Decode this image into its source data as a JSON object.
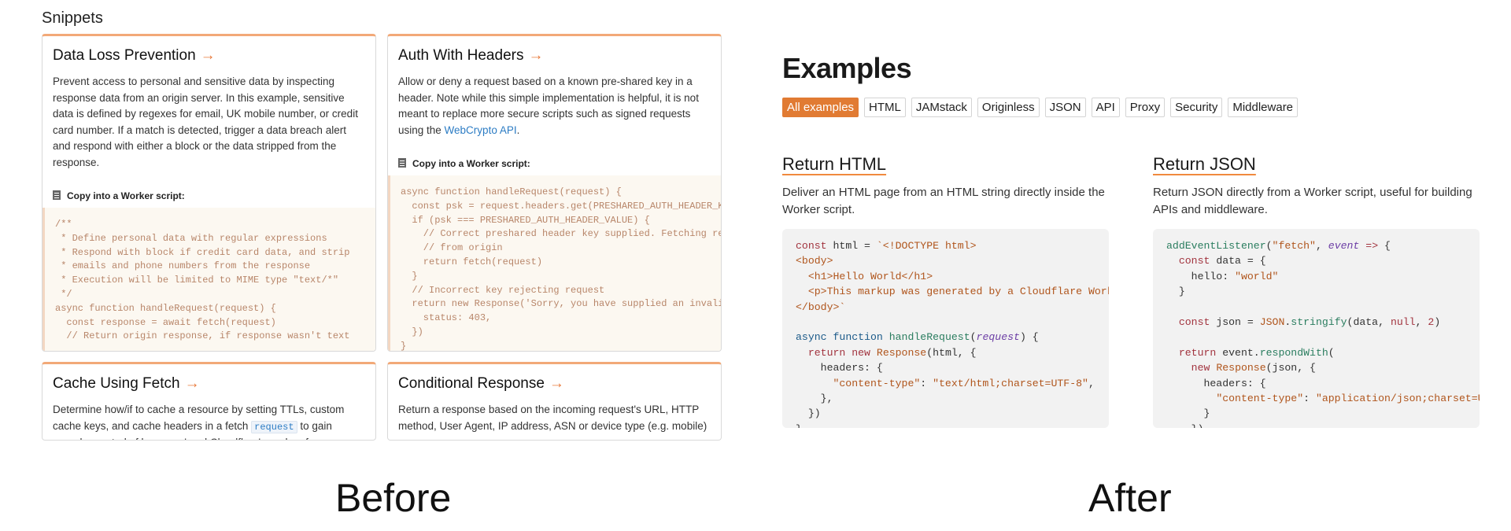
{
  "before": {
    "heading": "Snippets",
    "cards": [
      {
        "title": "Data Loss Prevention",
        "arrow": "→",
        "description": "Prevent access to personal and sensitive data by inspecting response data from an origin server. In this example, sensitive data is defined by regexes for email, UK mobile number, or credit card number. If a match is detected, trigger a data breach alert and respond with either a block or the data stripped from the response.",
        "copy_label": "Copy into a Worker script:",
        "code": "/**\n * Define personal data with regular expressions\n * Respond with block if credit card data, and strip\n * emails and phone numbers from the response\n * Execution will be limited to MIME type \"text/*\"\n */\nasync function handleRequest(request) {\n  const response = await fetch(request)\n  // Return origin response, if response wasn't text"
      },
      {
        "title": "Auth With Headers",
        "arrow": "→",
        "description_pre": "Allow or deny a request based on a known pre-shared key in a header. Note while this simple implementation is helpful, it is not meant to replace more secure scripts such as signed requests using the ",
        "description_link": "WebCrypto API",
        "description_post": ".",
        "copy_label": "Copy into a Worker script:",
        "code": "async function handleRequest(request) {\n  const psk = request.headers.get(PRESHARED_AUTH_HEADER_KEY)\n  if (psk === PRESHARED_AUTH_HEADER_VALUE) {\n    // Correct preshared header key supplied. Fetching request\n    // from origin\n    return fetch(request)\n  }\n  // Incorrect key rejecting request\n  return new Response('Sorry, you have supplied an invalid key.', {\n    status: 403,\n  })\n}"
      },
      {
        "title": "Cache Using Fetch",
        "arrow": "→",
        "description_pre": "Determine how/if to cache a resource by setting TTLs, custom cache keys, and cache headers in a fetch ",
        "description_code": "request",
        "description_post": " to gain granular control of browsers' and Cloudflare's caches for even"
      },
      {
        "title": "Conditional Response",
        "arrow": "→",
        "description": "Return a response based on the incoming request's URL, HTTP method, User Agent, IP address, ASN or device type (e.g. mobile)"
      }
    ]
  },
  "after": {
    "heading": "Examples",
    "filters": [
      {
        "label": "All examples",
        "active": true
      },
      {
        "label": "HTML",
        "active": false
      },
      {
        "label": "JAMstack",
        "active": false
      },
      {
        "label": "Originless",
        "active": false
      },
      {
        "label": "JSON",
        "active": false
      },
      {
        "label": "API",
        "active": false
      },
      {
        "label": "Proxy",
        "active": false
      },
      {
        "label": "Security",
        "active": false
      },
      {
        "label": "Middleware",
        "active": false
      }
    ],
    "examples": [
      {
        "title": "Return HTML",
        "description": "Deliver an HTML page from an HTML string directly inside the Worker script."
      },
      {
        "title": "Return JSON",
        "description": "Return JSON directly from a Worker script, useful for building APIs and middleware."
      }
    ]
  },
  "captions": {
    "before": "Before",
    "after": "After"
  },
  "colors": {
    "accent": "#e17b33",
    "card_border_top": "#f2a978",
    "link": "#2c7cc4"
  }
}
